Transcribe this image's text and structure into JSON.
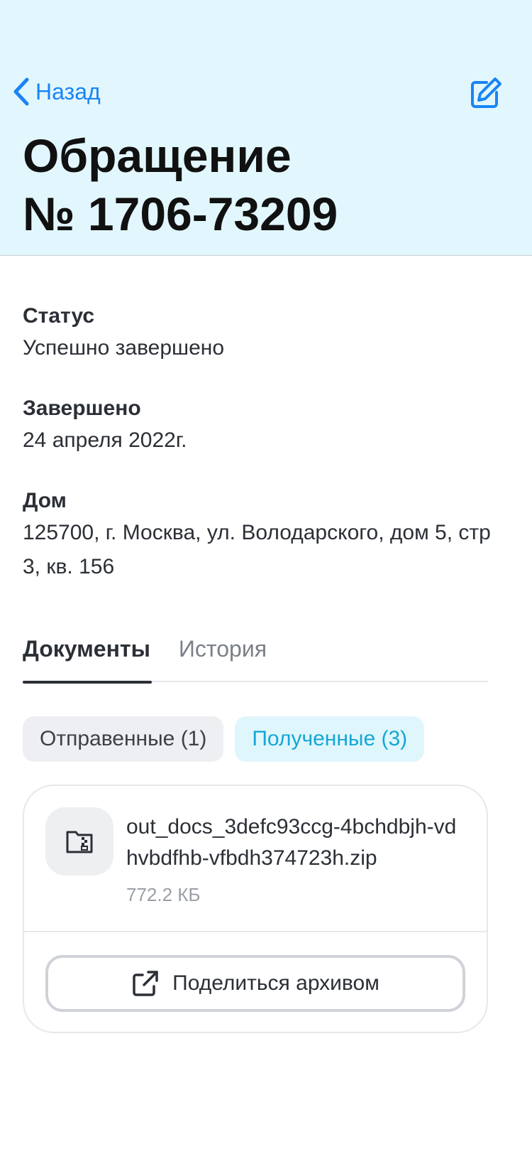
{
  "header": {
    "back_label": "Назад",
    "title_line1": "Обращение",
    "title_line2": "№ 1706-73209"
  },
  "details": {
    "status_label": "Статус",
    "status_value": "Успешно завершено",
    "completed_label": "Завершено",
    "completed_value": "24 апреля 2022г.",
    "house_label": "Дом",
    "house_value": "125700, г. Москва, ул. Володарского, дом 5, стр 3, кв. 156"
  },
  "tabs": [
    {
      "label": "Документы",
      "active": true
    },
    {
      "label": "История",
      "active": false
    }
  ],
  "filters": {
    "sent_label": "Отправенные (1)",
    "received_label": "Полученные (3)"
  },
  "file": {
    "name": "out_docs_3defc93ccg-4bchdbjh-vdhvbdfhb-vfbdh374723h.zip",
    "size": "772.2 КБ",
    "icon": "zip-folder-icon",
    "share_label": "Поделиться архивом"
  },
  "colors": {
    "header_bg": "#e2f7fd",
    "accent": "#1a84f5",
    "received_chip_text": "#13a7d4"
  }
}
